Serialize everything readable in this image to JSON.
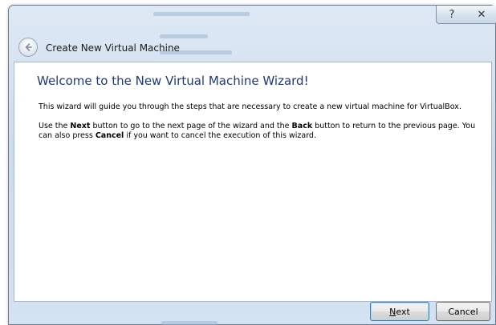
{
  "window": {
    "title": "Create New Virtual Machine",
    "help_glyph": "?",
    "close_glyph": "✕"
  },
  "wizard": {
    "heading": "Welcome to the New Virtual Machine Wizard!",
    "intro": "This wizard will guide you through the steps that are necessary to create a new virtual machine for VirtualBox.",
    "instructions": {
      "t1": "Use the ",
      "b1": "Next",
      "t2": " button to go to the next page of the wizard and the ",
      "b2": "Back",
      "t3": " button to return to the previous page. You can also press ",
      "b3": "Cancel",
      "t4": " if you want to cancel the execution of this wizard."
    }
  },
  "buttons": {
    "next_mnemonic": "N",
    "next_rest": "ext",
    "cancel": "Cancel"
  },
  "icons": {
    "back": "back-arrow-icon",
    "help": "help-icon",
    "close": "close-icon"
  }
}
